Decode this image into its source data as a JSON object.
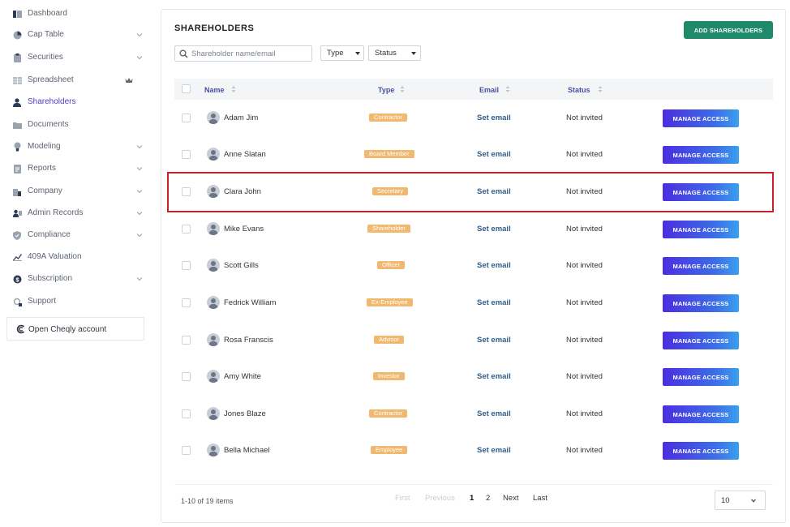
{
  "sidebar": {
    "items": [
      {
        "label": "Dashboard",
        "icon": "dashboard-icon"
      },
      {
        "label": "Cap Table",
        "icon": "pie-chart-icon"
      },
      {
        "label": "Securities",
        "icon": "clipboard-icon"
      },
      {
        "label": "Spreadsheet",
        "icon": "table-icon"
      },
      {
        "label": "Shareholders",
        "icon": "person-icon"
      },
      {
        "label": "Documents",
        "icon": "folder-icon"
      },
      {
        "label": "Modeling",
        "icon": "lightbulb-icon"
      },
      {
        "label": "Reports",
        "icon": "report-icon"
      },
      {
        "label": "Company",
        "icon": "building-icon"
      },
      {
        "label": "Admin Records",
        "icon": "admin-icon"
      },
      {
        "label": "Compliance",
        "icon": "shield-icon"
      },
      {
        "label": "409A Valuation",
        "icon": "chart-icon"
      },
      {
        "label": "Subscription",
        "icon": "dollar-icon"
      },
      {
        "label": "Support",
        "icon": "support-icon"
      }
    ],
    "cheqly_label": "Open Cheqly account",
    "active_color": "#4b3fbd"
  },
  "main": {
    "title": "SHAREHOLDERS",
    "add_button": "ADD SHAREHOLDERS",
    "search_placeholder": "Shareholder name/email",
    "type_filter": "Type",
    "status_filter": "Status",
    "columns": {
      "name": "Name",
      "type": "Type",
      "email": "Email",
      "status": "Status"
    },
    "rows": [
      {
        "name": "Adam Jim",
        "type": "Contractor",
        "email": "Set email",
        "status": "Not invited",
        "action": "MANAGE ACCESS"
      },
      {
        "name": "Anne Slatan",
        "type": "Board Member",
        "email": "Set email",
        "status": "Not invited",
        "action": "MANAGE ACCESS"
      },
      {
        "name": "Clara John",
        "type": "Secretary",
        "email": "Set email",
        "status": "Not invited",
        "action": "MANAGE ACCESS"
      },
      {
        "name": "Mike Evans",
        "type": "Shareholder",
        "email": "Set email",
        "status": "Not invited",
        "action": "MANAGE ACCESS"
      },
      {
        "name": "Scott Gills",
        "type": "Officer",
        "email": "Set email",
        "status": "Not invited",
        "action": "MANAGE ACCESS"
      },
      {
        "name": "Fedrick William",
        "type": "Ex-Employee",
        "email": "Set email",
        "status": "Not invited",
        "action": "MANAGE ACCESS"
      },
      {
        "name": "Rosa Franscis",
        "type": "Advisor",
        "email": "Set email",
        "status": "Not invited",
        "action": "MANAGE ACCESS"
      },
      {
        "name": "Amy White",
        "type": "Investor",
        "email": "Set email",
        "status": "Not invited",
        "action": "MANAGE ACCESS"
      },
      {
        "name": "Jones Blaze",
        "type": "Contractor",
        "email": "Set email",
        "status": "Not invited",
        "action": "MANAGE ACCESS"
      },
      {
        "name": "Bella Michael",
        "type": "Employee",
        "email": "Set email",
        "status": "Not invited",
        "action": "MANAGE ACCESS"
      }
    ],
    "pagination": {
      "summary": "1-10 of 19 items",
      "first": "First",
      "previous": "Previous",
      "page1": "1",
      "page2": "2",
      "next": "Next",
      "last": "Last",
      "page_size": "10"
    },
    "colors": {
      "add_button": "#1f8a6a",
      "badge": "#f0b96f",
      "email_link": "#2f5d8a",
      "highlight": "#c8202a"
    }
  }
}
